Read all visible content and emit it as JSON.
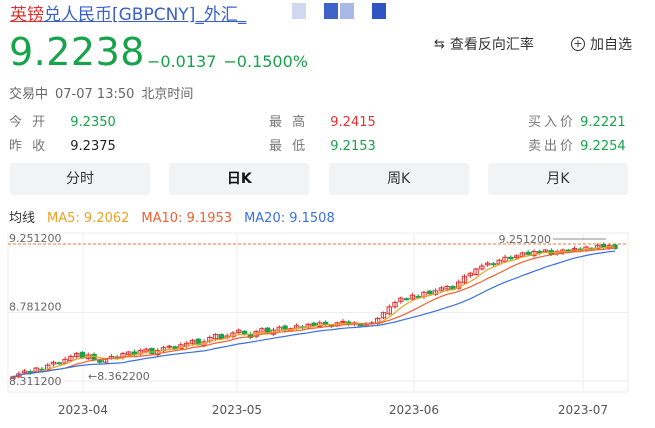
{
  "header": {
    "title_cn": "英镑",
    "title_rest": "兑人民币[GBPCNY]_外汇_",
    "price": "9.2238",
    "change_abs": "−0.0137",
    "change_pct": "−0.1500%",
    "reverse_rate_label": "查看反向汇率",
    "watchlist_label": "加自选",
    "status": "交易中",
    "datetime": "07-07 13:50",
    "timezone": "北京时间",
    "colors": {
      "down": "#16a34a",
      "up": "#e03030",
      "title_cn": "#e03030",
      "title_link": "#3a5fcd"
    }
  },
  "quote": {
    "open_label": "今 开",
    "open_value": "9.2350",
    "prev_close_label": "昨 收",
    "prev_close_value": "9.2375",
    "high_label": "最 高",
    "high_value": "9.2415",
    "low_label": "最 低",
    "low_value": "9.2153",
    "bid_label": "买入价",
    "bid_value": "9.2221",
    "ask_label": "卖出价",
    "ask_value": "9.2254"
  },
  "tabs": [
    {
      "label": "分时",
      "active": false
    },
    {
      "label": "日K",
      "active": true
    },
    {
      "label": "周K",
      "active": false
    },
    {
      "label": "月K",
      "active": false
    }
  ],
  "ma": {
    "title": "均线",
    "ma5": "MA5: 9.2062",
    "ma10": "MA10: 9.1953",
    "ma20": "MA20: 9.1508",
    "colors": {
      "ma5": "#f0a020",
      "ma10": "#f06030",
      "ma20": "#3b6fe0"
    }
  },
  "chart_data": {
    "type": "candlestick",
    "y_ticks": [
      "9.251200",
      "8.781200",
      "8.311200"
    ],
    "x_ticks": [
      "2023-04",
      "2023-05",
      "2023-06",
      "2023-07"
    ],
    "annotations": {
      "max_label": "9.251200",
      "min_label": "8.362200"
    },
    "ylim": [
      8.3112,
      9.2512
    ],
    "reference_line": 9.2512,
    "series_close": [
      8.34,
      8.36,
      8.38,
      8.37,
      8.4,
      8.39,
      8.42,
      8.44,
      8.43,
      8.46,
      8.48,
      8.5,
      8.47,
      8.49,
      8.46,
      8.44,
      8.46,
      8.48,
      8.47,
      8.5,
      8.51,
      8.49,
      8.52,
      8.53,
      8.5,
      8.52,
      8.54,
      8.55,
      8.53,
      8.56,
      8.57,
      8.59,
      8.56,
      8.58,
      8.61,
      8.63,
      8.6,
      8.62,
      8.64,
      8.66,
      8.63,
      8.61,
      8.65,
      8.67,
      8.64,
      8.66,
      8.68,
      8.66,
      8.67,
      8.69,
      8.68,
      8.7,
      8.69,
      8.71,
      8.7,
      8.69,
      8.71,
      8.72,
      8.7,
      8.71,
      8.69,
      8.7,
      8.71,
      8.74,
      8.78,
      8.82,
      8.85,
      8.88,
      8.87,
      8.9,
      8.89,
      8.92,
      8.91,
      8.93,
      8.95,
      8.96,
      8.94,
      8.99,
      9.03,
      9.05,
      9.08,
      9.1,
      9.12,
      9.11,
      9.14,
      9.16,
      9.15,
      9.17,
      9.19,
      9.18,
      9.2,
      9.19,
      9.21,
      9.18,
      9.2,
      9.21,
      9.2,
      9.22,
      9.21,
      9.23,
      9.22,
      9.24,
      9.23,
      9.24,
      9.22
    ]
  }
}
